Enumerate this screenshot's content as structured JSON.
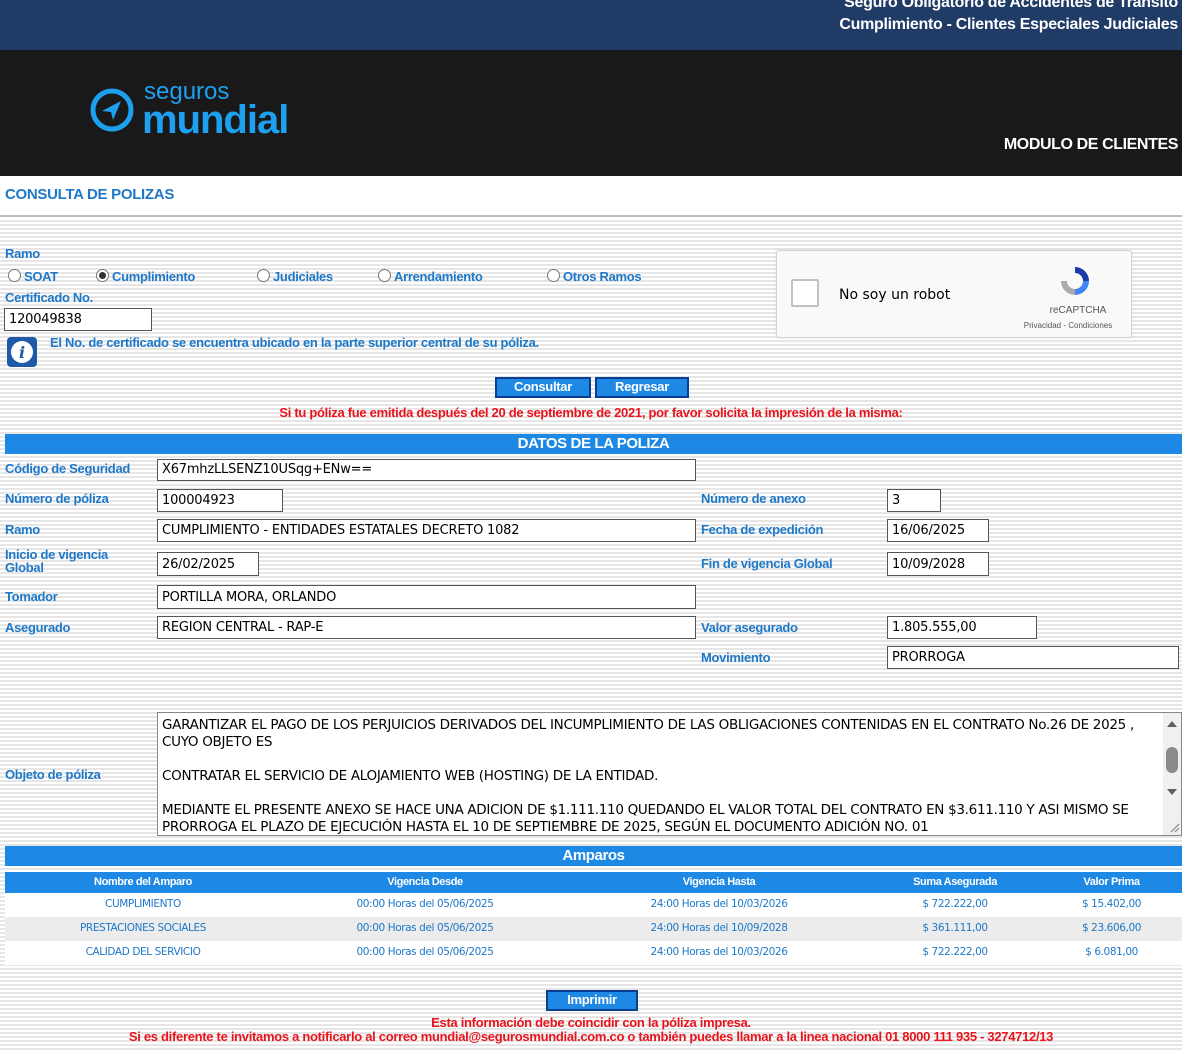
{
  "header": {
    "title_line1": "Seguro Obligatorio de Accidentes de Tránsito",
    "title_line2": "Cumplimiento - Clientes Especiales Judiciales",
    "logo_top": "seguros",
    "logo_bottom": "mundial",
    "module": "MODULO DE CLIENTES"
  },
  "page_title": "CONSULTA DE POLIZAS",
  "form": {
    "ramo_label": "Ramo",
    "radios": [
      {
        "label": "SOAT",
        "selected": false
      },
      {
        "label": "Cumplimiento",
        "selected": true
      },
      {
        "label": "Judiciales",
        "selected": false
      },
      {
        "label": "Arrendamiento",
        "selected": false
      },
      {
        "label": "Otros Ramos",
        "selected": false
      }
    ],
    "certificado_label": "Certificado No.",
    "certificado_value": "120049838",
    "info_text": "El No. de certificado se encuentra ubicado en la parte superior central de su póliza.",
    "consultar_label": "Consultar",
    "regresar_label": "Regresar",
    "notice": "Si tu póliza fue emitida después del 20 de septiembre de 2021, por favor solicita la impresión de la misma:"
  },
  "captcha": {
    "text": "No soy un robot",
    "brand": "reCAPTCHA",
    "links": "Privacidad - Condiciones"
  },
  "poliza": {
    "section_title": "DATOS DE LA POLIZA",
    "codigo_label": "Código de Seguridad",
    "codigo_value": "X67mhzLLSENZ10USqg+ENw==",
    "numero_label": "Número de póliza",
    "numero_value": "100004923",
    "anexo_label": "Número de anexo",
    "anexo_value": "3",
    "ramo_label": "Ramo",
    "ramo_value": "CUMPLIMIENTO - ENTIDADES ESTATALES DECRETO 1082",
    "expedicion_label": "Fecha de expedición",
    "expedicion_value": "16/06/2025",
    "inicio_label": "Inicio de vigencia Global",
    "inicio_value": "26/02/2025",
    "fin_label": "Fin de vigencia Global",
    "fin_value": "10/09/2028",
    "tomador_label": "Tomador",
    "tomador_value": "PORTILLA MORA, ORLANDO",
    "asegurado_label": "Asegurado",
    "asegurado_value": "REGION CENTRAL - RAP-E",
    "valor_label": "Valor asegurado",
    "valor_value": "1.805.555,00",
    "movimiento_label": "Movimiento",
    "movimiento_value": "PRORROGA",
    "objeto_label": "Objeto de póliza",
    "objeto_value": "GARANTIZAR EL PAGO DE LOS PERJUICIOS DERIVADOS DEL INCUMPLIMIENTO DE LAS OBLIGACIONES CONTENIDAS EN EL CONTRATO No.26 DE 2025 , CUYO OBJETO ES\n\nCONTRATAR EL SERVICIO DE ALOJAMIENTO WEB (HOSTING) DE LA ENTIDAD.\n\nMEDIANTE EL PRESENTE ANEXO SE HACE UNA ADICION DE $1.111.110 QUEDANDO EL VALOR TOTAL DEL CONTRATO EN $3.611.110 Y ASI MISMO SE PRORROGA EL PLAZO DE EJECUCIÓN HASTA EL 10 DE SEPTIEMBRE DE 2025, SEGÚN EL DOCUMENTO ADICIÓN NO. 01"
  },
  "amparos": {
    "section_title": "Amparos",
    "columns": [
      "Nombre del Amparo",
      "Vigencia Desde",
      "Vigencia Hasta",
      "Suma Asegurada",
      "Valor Prima"
    ],
    "rows": [
      [
        "CUMPLIMIENTO",
        "00:00 Horas del 05/06/2025",
        "24:00 Horas del 10/03/2026",
        "$ 722.222,00",
        "$ 15.402,00"
      ],
      [
        "PRESTACIONES SOCIALES",
        "00:00 Horas del 05/06/2025",
        "24:00 Horas del 10/09/2028",
        "$ 361.111,00",
        "$ 23.606,00"
      ],
      [
        "CALIDAD DEL SERVICIO",
        "00:00 Horas del 05/06/2025",
        "24:00 Horas del 10/03/2026",
        "$ 722.222,00",
        "$ 6.081,00"
      ]
    ]
  },
  "footer": {
    "imprimir_label": "Imprimir",
    "note1": "Esta información debe coincidir con la póliza impresa.",
    "note2": "Si es diferente te invitamos a notificarlo al correo mundial@segurosmundial.com.co o también puedes llamar a la linea nacional 01 8000 111 935 - 3274712/13"
  },
  "colors": {
    "brand_blue": "#1e78c8",
    "bar_blue": "#1e88e5",
    "alert_red": "#e8131b",
    "header_navy": "#1f3b66"
  }
}
